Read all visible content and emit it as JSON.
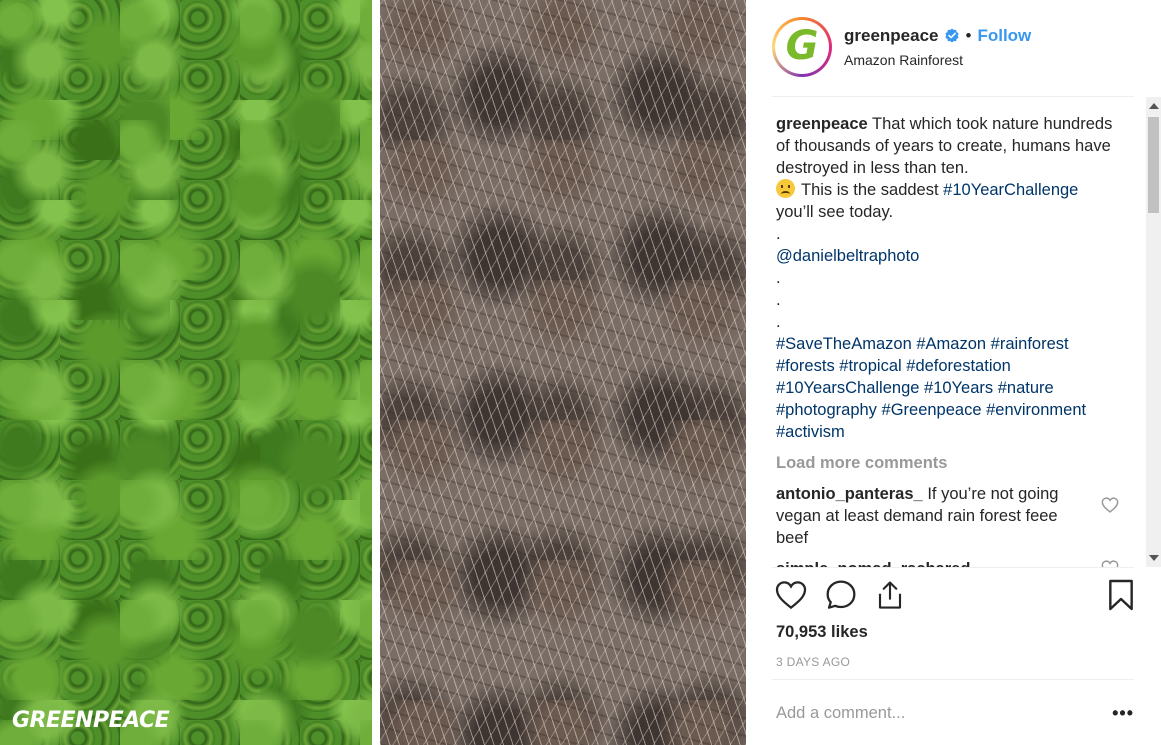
{
  "photo": {
    "watermark": "GREENPEACE"
  },
  "header": {
    "avatar_letter": "G",
    "username": "greenpeace",
    "dot": "•",
    "follow_label": "Follow",
    "location": "Amazon Rainforest",
    "verified_icon": "verified-badge-icon"
  },
  "caption": {
    "username": "greenpeace",
    "text_1": "That which took nature hundreds of thousands of years to create, humans have destroyed in less than ten.",
    "emoji": "disappointed-face-emoji",
    "text_2": "This is the saddest",
    "hashtag_1": "#10YearChallenge",
    "text_3": "you’ll see today.",
    "dot_1": ".",
    "mention": "@danielbeltraphoto",
    "dot_2": ".",
    "dot_3": ".",
    "dot_4": ".",
    "hashtags": [
      "#SaveTheAmazon",
      "#Amazon",
      "#rainforest",
      "#forests",
      "#tropical",
      "#deforestation",
      "#10YearsChallenge",
      "#10Years",
      "#nature",
      "#photography",
      "#Greenpeace",
      "#environment",
      "#activism"
    ]
  },
  "load_more_label": "Load more comments",
  "comments": [
    {
      "username": "antonio_panteras_",
      "text": "If you’re not going vegan at least demand rain forest feee beef"
    },
    {
      "username": "simple_nomad_rachared",
      "text": ""
    }
  ],
  "actions": {
    "like_icon": "heart-icon",
    "comment_icon": "comment-bubble-icon",
    "share_icon": "share-icon",
    "save_icon": "bookmark-icon"
  },
  "likes": "70,953 likes",
  "timestamp": "3 DAYS AGO",
  "comment_box": {
    "placeholder": "Add a comment...",
    "more_label": "•••"
  },
  "colors": {
    "link": "#003569",
    "follow": "#3897f0",
    "muted": "#999999",
    "brand_green": "#7ab929"
  }
}
